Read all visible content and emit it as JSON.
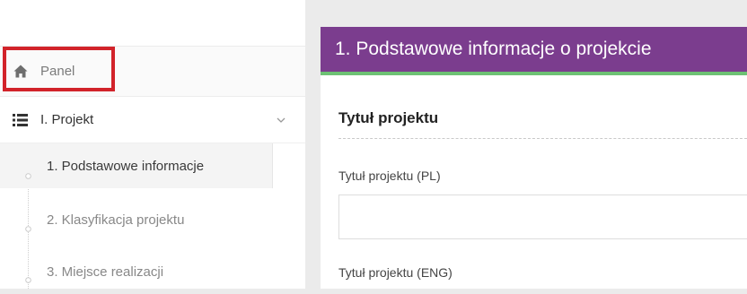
{
  "sidebar": {
    "panel": {
      "label": "Panel",
      "icon": "home-icon"
    },
    "project": {
      "label": "I. Projekt",
      "icon": "list-icon",
      "expanded": true
    },
    "sub_items": [
      {
        "label": "1. Podstawowe informacje",
        "active": true
      },
      {
        "label": "2. Klasyfikacja projektu",
        "active": false
      },
      {
        "label": "3. Miejsce realizacji",
        "active": false
      }
    ]
  },
  "main": {
    "header_title": "1. Podstawowe informacje o projekcie",
    "section_title": "Tytuł projektu",
    "fields": [
      {
        "label": "Tytuł projektu (PL)",
        "value": ""
      },
      {
        "label": "Tytuł projektu (ENG)"
      }
    ]
  },
  "colors": {
    "header_background": "#7b3d8e",
    "header_accent": "#6dc174",
    "highlight": "#d2232a"
  }
}
